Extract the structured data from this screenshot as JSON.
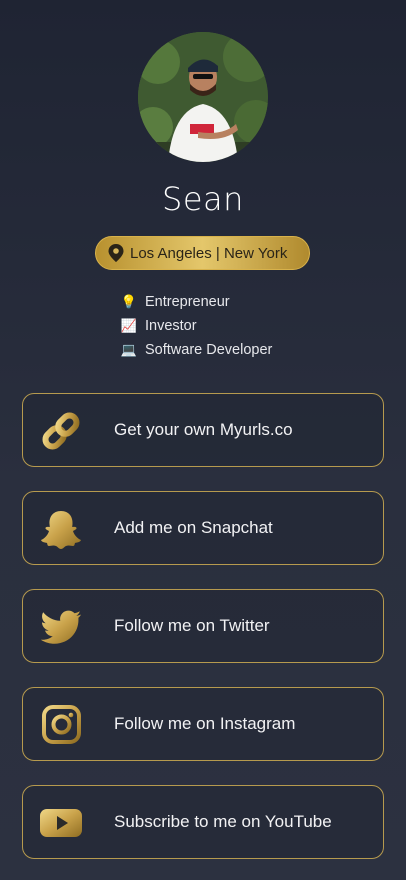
{
  "profile": {
    "name": "Sean",
    "location": "Los Angeles | New York",
    "avatar_alt": "profile photo"
  },
  "bio": [
    {
      "icon": "lightbulb-icon",
      "emoji": "💡",
      "text": "Entrepreneur"
    },
    {
      "icon": "chart-icon",
      "emoji": "📈",
      "text": "Investor"
    },
    {
      "icon": "laptop-icon",
      "emoji": "💻",
      "text": "Software Developer"
    }
  ],
  "links": [
    {
      "icon": "link-icon",
      "label": "Get your own Myurls.co"
    },
    {
      "icon": "snapchat-icon",
      "label": "Add me on Snapchat"
    },
    {
      "icon": "twitter-icon",
      "label": "Follow me on Twitter"
    },
    {
      "icon": "instagram-icon",
      "label": "Follow me on Instagram"
    },
    {
      "icon": "youtube-icon",
      "label": "Subscribe to me on YouTube"
    }
  ],
  "colors": {
    "background": "#242938",
    "gold": "#c9a64a",
    "border": "#b69a4e"
  }
}
